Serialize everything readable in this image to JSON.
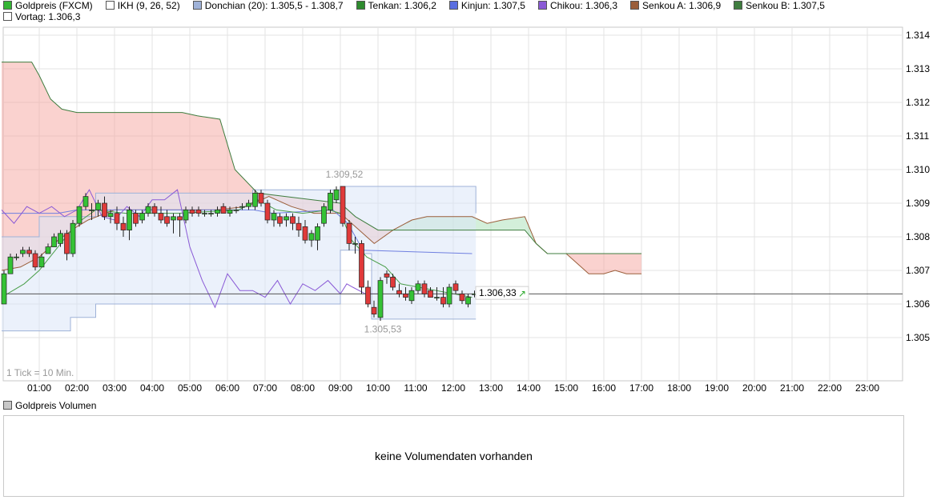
{
  "legend": {
    "items": [
      {
        "label": "Goldpreis (FXCM)",
        "color": "#35b535",
        "icon": "filled-square"
      },
      {
        "label": "IKH (9, 26, 52)",
        "color": "#ffffff",
        "icon": "empty-square"
      },
      {
        "label": "Donchian (20): 1.305,5 - 1.308,7",
        "color": "#9fb2d8",
        "icon": "filled-square"
      },
      {
        "label": "Tenkan: 1.306,2",
        "color": "#2e8b2e",
        "icon": "filled-square"
      },
      {
        "label": "Kinjun: 1.307,5",
        "color": "#5a6ee0",
        "icon": "filled-square"
      },
      {
        "label": "Chikou: 1.306,3",
        "color": "#8a5ad6",
        "icon": "filled-square"
      },
      {
        "label": "Senkou A: 1.306,9",
        "color": "#9a5e3a",
        "icon": "filled-square"
      },
      {
        "label": "Senkou B: 1.307,5",
        "color": "#3f7d3f",
        "icon": "filled-square"
      }
    ],
    "vortag": {
      "label": "Vortag: 1.306,3",
      "color": "#ffffff",
      "icon": "empty-square"
    }
  },
  "chart_data": {
    "type": "candlestick",
    "title": "",
    "y_ticks": [
      "1.314",
      "1.313",
      "1.312",
      "1.311",
      "1.310",
      "1.309",
      "1.308",
      "1.307",
      "1.306",
      "1.305"
    ],
    "ylim": [
      1304.4,
      1314.3
    ],
    "x_ticks": [
      "01:00",
      "02:00",
      "03:00",
      "04:00",
      "05:00",
      "06:00",
      "07:00",
      "08:00",
      "09:00",
      "10:00",
      "11:00",
      "12:00",
      "13:00",
      "14:00",
      "15:00",
      "16:00",
      "17:00",
      "18:00",
      "19:00",
      "20:00",
      "21:00",
      "22:00",
      "23:00"
    ],
    "xlim_hours": [
      0,
      24
    ],
    "grid": true,
    "tick_note": "1 Tick = 10 Min.",
    "annotations": {
      "high_label": "1.309,52",
      "low_label": "1.305,53",
      "last_label": "1.306,33"
    },
    "last_value": 1306.33,
    "vortag_line": 1306.3,
    "colors": {
      "up": "#35c235",
      "down": "#e03a3a",
      "cloud_bear": "#f5a5a0",
      "cloud_bull": "#a8dfb5",
      "donchian_fill": "#dbe6f8",
      "donchian_line": "#9fb2d8",
      "tenkan": "#4a9e4a",
      "kinjun": "#6f7fe0",
      "chikou": "#8a5ad6",
      "senkou_a": "#9a5e3a",
      "senkou_b": "#3f7d3f",
      "vortag": "#555555"
    },
    "candles": [
      {
        "t": 0.0,
        "o": 1306.0,
        "h": 1307.0,
        "l": 1306.0,
        "c": 1306.9
      },
      {
        "t": 0.17,
        "o": 1306.9,
        "h": 1307.5,
        "l": 1306.9,
        "c": 1307.4
      },
      {
        "t": 0.33,
        "o": 1307.4,
        "h": 1307.5,
        "l": 1307.3,
        "c": 1307.4
      },
      {
        "t": 0.5,
        "o": 1307.5,
        "h": 1307.7,
        "l": 1307.4,
        "c": 1307.6
      },
      {
        "t": 0.67,
        "o": 1307.6,
        "h": 1307.7,
        "l": 1307.4,
        "c": 1307.5
      },
      {
        "t": 0.83,
        "o": 1307.5,
        "h": 1307.6,
        "l": 1307.0,
        "c": 1307.1
      },
      {
        "t": 1.0,
        "o": 1307.1,
        "h": 1307.5,
        "l": 1307.1,
        "c": 1307.4
      },
      {
        "t": 1.17,
        "o": 1307.5,
        "h": 1307.8,
        "l": 1307.5,
        "c": 1307.7
      },
      {
        "t": 1.33,
        "o": 1307.7,
        "h": 1308.1,
        "l": 1307.7,
        "c": 1308.0
      },
      {
        "t": 1.5,
        "o": 1307.8,
        "h": 1308.2,
        "l": 1307.7,
        "c": 1308.1
      },
      {
        "t": 1.67,
        "o": 1308.1,
        "h": 1308.2,
        "l": 1307.3,
        "c": 1307.5
      },
      {
        "t": 1.83,
        "o": 1307.5,
        "h": 1308.5,
        "l": 1307.4,
        "c": 1308.4
      },
      {
        "t": 2.0,
        "o": 1308.4,
        "h": 1308.9,
        "l": 1308.3,
        "c": 1308.9
      },
      {
        "t": 2.17,
        "o": 1308.9,
        "h": 1309.3,
        "l": 1308.8,
        "c": 1309.2
      },
      {
        "t": 2.33,
        "o": 1308.8,
        "h": 1309.0,
        "l": 1308.5,
        "c": 1308.8
      },
      {
        "t": 2.5,
        "o": 1308.8,
        "h": 1309.1,
        "l": 1308.6,
        "c": 1309.0
      },
      {
        "t": 2.67,
        "o": 1309.0,
        "h": 1309.2,
        "l": 1308.5,
        "c": 1308.6
      },
      {
        "t": 2.83,
        "o": 1308.6,
        "h": 1308.8,
        "l": 1308.4,
        "c": 1308.7
      },
      {
        "t": 3.0,
        "o": 1308.7,
        "h": 1308.9,
        "l": 1308.2,
        "c": 1308.4
      },
      {
        "t": 3.17,
        "o": 1308.4,
        "h": 1308.6,
        "l": 1308.0,
        "c": 1308.2
      },
      {
        "t": 3.33,
        "o": 1308.2,
        "h": 1308.9,
        "l": 1307.9,
        "c": 1308.8
      },
      {
        "t": 3.5,
        "o": 1308.7,
        "h": 1308.8,
        "l": 1308.3,
        "c": 1308.4
      },
      {
        "t": 3.67,
        "o": 1308.5,
        "h": 1308.8,
        "l": 1308.4,
        "c": 1308.7
      },
      {
        "t": 3.83,
        "o": 1308.7,
        "h": 1309.0,
        "l": 1308.6,
        "c": 1308.9
      },
      {
        "t": 4.0,
        "o": 1308.9,
        "h": 1309.0,
        "l": 1308.6,
        "c": 1308.7
      },
      {
        "t": 4.17,
        "o": 1308.7,
        "h": 1308.9,
        "l": 1308.4,
        "c": 1308.5
      },
      {
        "t": 4.33,
        "o": 1308.6,
        "h": 1308.8,
        "l": 1308.3,
        "c": 1308.4
      },
      {
        "t": 4.5,
        "o": 1308.5,
        "h": 1308.7,
        "l": 1308.1,
        "c": 1308.6
      },
      {
        "t": 4.67,
        "o": 1308.6,
        "h": 1308.7,
        "l": 1308.0,
        "c": 1308.5
      },
      {
        "t": 4.83,
        "o": 1308.5,
        "h": 1308.9,
        "l": 1308.4,
        "c": 1308.8
      },
      {
        "t": 5.0,
        "o": 1308.8,
        "h": 1308.9,
        "l": 1308.6,
        "c": 1308.7
      },
      {
        "t": 5.17,
        "o": 1308.8,
        "h": 1308.9,
        "l": 1308.6,
        "c": 1308.7
      },
      {
        "t": 5.33,
        "o": 1308.7,
        "h": 1308.8,
        "l": 1308.6,
        "c": 1308.7
      },
      {
        "t": 5.5,
        "o": 1308.7,
        "h": 1308.8,
        "l": 1308.6,
        "c": 1308.7
      },
      {
        "t": 5.67,
        "o": 1308.7,
        "h": 1308.9,
        "l": 1308.6,
        "c": 1308.8
      },
      {
        "t": 5.83,
        "o": 1308.9,
        "h": 1309.0,
        "l": 1308.7,
        "c": 1308.7
      },
      {
        "t": 6.0,
        "o": 1308.7,
        "h": 1308.9,
        "l": 1308.6,
        "c": 1308.8
      },
      {
        "t": 6.17,
        "o": 1308.8,
        "h": 1308.9,
        "l": 1308.7,
        "c": 1308.8
      },
      {
        "t": 6.33,
        "o": 1308.9,
        "h": 1309.0,
        "l": 1308.8,
        "c": 1308.9
      },
      {
        "t": 6.5,
        "o": 1308.9,
        "h": 1309.1,
        "l": 1308.8,
        "c": 1309.0
      },
      {
        "t": 6.67,
        "o": 1308.9,
        "h": 1309.4,
        "l": 1308.8,
        "c": 1309.3
      },
      {
        "t": 6.83,
        "o": 1309.3,
        "h": 1309.4,
        "l": 1308.9,
        "c": 1309.0
      },
      {
        "t": 7.0,
        "o": 1309.0,
        "h": 1309.1,
        "l": 1308.4,
        "c": 1308.5
      },
      {
        "t": 7.17,
        "o": 1308.5,
        "h": 1308.8,
        "l": 1308.3,
        "c": 1308.7
      },
      {
        "t": 7.33,
        "o": 1308.6,
        "h": 1308.7,
        "l": 1308.3,
        "c": 1308.4
      },
      {
        "t": 7.5,
        "o": 1308.5,
        "h": 1308.7,
        "l": 1308.3,
        "c": 1308.6
      },
      {
        "t": 7.67,
        "o": 1308.6,
        "h": 1308.7,
        "l": 1308.2,
        "c": 1308.4
      },
      {
        "t": 7.83,
        "o": 1308.4,
        "h": 1308.6,
        "l": 1308.0,
        "c": 1308.2
      },
      {
        "t": 8.0,
        "o": 1308.3,
        "h": 1308.5,
        "l": 1307.8,
        "c": 1307.9
      },
      {
        "t": 8.17,
        "o": 1307.9,
        "h": 1308.2,
        "l": 1307.7,
        "c": 1308.1
      },
      {
        "t": 8.33,
        "o": 1307.9,
        "h": 1308.4,
        "l": 1307.6,
        "c": 1308.3
      },
      {
        "t": 8.5,
        "o": 1308.4,
        "h": 1309.0,
        "l": 1308.3,
        "c": 1308.9
      },
      {
        "t": 8.67,
        "o": 1308.8,
        "h": 1309.4,
        "l": 1308.7,
        "c": 1309.3
      },
      {
        "t": 8.83,
        "o": 1309.1,
        "h": 1309.5,
        "l": 1309.0,
        "c": 1309.4
      },
      {
        "t": 9.0,
        "o": 1309.5,
        "h": 1309.5,
        "l": 1308.3,
        "c": 1308.4
      },
      {
        "t": 9.17,
        "o": 1308.4,
        "h": 1308.5,
        "l": 1307.6,
        "c": 1307.8
      },
      {
        "t": 9.33,
        "o": 1307.8,
        "h": 1308.0,
        "l": 1307.5,
        "c": 1307.8
      },
      {
        "t": 9.5,
        "o": 1307.8,
        "h": 1307.9,
        "l": 1306.3,
        "c": 1306.5
      },
      {
        "t": 9.67,
        "o": 1306.5,
        "h": 1306.7,
        "l": 1305.9,
        "c": 1306.0
      },
      {
        "t": 9.83,
        "o": 1305.9,
        "h": 1306.1,
        "l": 1305.6,
        "c": 1305.7
      },
      {
        "t": 10.0,
        "o": 1305.6,
        "h": 1306.8,
        "l": 1305.5,
        "c": 1306.7
      },
      {
        "t": 10.17,
        "o": 1306.9,
        "h": 1307.0,
        "l": 1306.6,
        "c": 1306.8
      },
      {
        "t": 10.33,
        "o": 1306.8,
        "h": 1306.9,
        "l": 1306.4,
        "c": 1306.5
      },
      {
        "t": 10.5,
        "o": 1306.4,
        "h": 1306.6,
        "l": 1306.2,
        "c": 1306.3
      },
      {
        "t": 10.67,
        "o": 1306.3,
        "h": 1306.5,
        "l": 1306.1,
        "c": 1306.2
      },
      {
        "t": 10.83,
        "o": 1306.1,
        "h": 1306.5,
        "l": 1306.0,
        "c": 1306.4
      },
      {
        "t": 11.0,
        "o": 1306.4,
        "h": 1306.7,
        "l": 1306.3,
        "c": 1306.6
      },
      {
        "t": 11.17,
        "o": 1306.6,
        "h": 1306.7,
        "l": 1306.2,
        "c": 1306.3
      },
      {
        "t": 11.33,
        "o": 1306.4,
        "h": 1306.5,
        "l": 1306.2,
        "c": 1306.2
      },
      {
        "t": 11.5,
        "o": 1306.2,
        "h": 1306.5,
        "l": 1306.1,
        "c": 1306.2
      },
      {
        "t": 11.67,
        "o": 1306.2,
        "h": 1306.5,
        "l": 1305.9,
        "c": 1306.0
      },
      {
        "t": 11.83,
        "o": 1306.0,
        "h": 1306.6,
        "l": 1305.9,
        "c": 1306.5
      },
      {
        "t": 12.0,
        "o": 1306.6,
        "h": 1306.7,
        "l": 1306.3,
        "c": 1306.4
      },
      {
        "t": 12.17,
        "o": 1306.3,
        "h": 1306.4,
        "l": 1306.0,
        "c": 1306.1
      },
      {
        "t": 12.33,
        "o": 1306.0,
        "h": 1306.3,
        "l": 1305.9,
        "c": 1306.2
      },
      {
        "t": 12.5,
        "o": 1306.3,
        "h": 1306.4,
        "l": 1306.2,
        "c": 1306.3
      }
    ],
    "donchian": [
      {
        "t": 0.0,
        "u": 1308.0,
        "l": 1305.2
      },
      {
        "t": 1.0,
        "u": 1308.6,
        "l": 1305.2
      },
      {
        "t": 1.83,
        "u": 1308.6,
        "l": 1305.6
      },
      {
        "t": 2.5,
        "u": 1309.3,
        "l": 1306.0
      },
      {
        "t": 3.33,
        "u": 1309.3,
        "l": 1306.0
      },
      {
        "t": 6.67,
        "u": 1309.4,
        "l": 1306.0
      },
      {
        "t": 9.0,
        "u": 1309.5,
        "l": 1307.6
      },
      {
        "t": 9.5,
        "u": 1309.5,
        "l": 1307.5
      },
      {
        "t": 9.83,
        "u": 1309.5,
        "l": 1305.55
      },
      {
        "t": 12.5,
        "u": 1309.5,
        "l": 1305.55
      },
      {
        "t": 12.6,
        "u": 1308.7,
        "l": 1305.55
      }
    ],
    "tenkan": [
      {
        "t": 0.0,
        "v": 1306.2
      },
      {
        "t": 0.6,
        "v": 1306.6
      },
      {
        "t": 1.0,
        "v": 1307.0
      },
      {
        "t": 1.5,
        "v": 1307.7
      },
      {
        "t": 2.0,
        "v": 1308.4
      },
      {
        "t": 2.5,
        "v": 1308.8
      },
      {
        "t": 3.3,
        "v": 1308.7
      },
      {
        "t": 4.7,
        "v": 1308.7
      },
      {
        "t": 6.3,
        "v": 1308.8
      },
      {
        "t": 6.8,
        "v": 1309.1
      },
      {
        "t": 7.3,
        "v": 1308.8
      },
      {
        "t": 8.0,
        "v": 1308.7
      },
      {
        "t": 8.7,
        "v": 1308.8
      },
      {
        "t": 9.0,
        "v": 1308.7
      },
      {
        "t": 9.3,
        "v": 1307.9
      },
      {
        "t": 9.7,
        "v": 1307.4
      },
      {
        "t": 10.2,
        "v": 1307.1
      },
      {
        "t": 10.6,
        "v": 1306.6
      },
      {
        "t": 12.5,
        "v": 1306.2
      }
    ],
    "kinjun": [
      {
        "t": 0.0,
        "v": 1308.7
      },
      {
        "t": 1.5,
        "v": 1308.7
      },
      {
        "t": 2.0,
        "v": 1308.8
      },
      {
        "t": 6.7,
        "v": 1308.8
      },
      {
        "t": 7.2,
        "v": 1308.7
      },
      {
        "t": 8.8,
        "v": 1308.8
      },
      {
        "t": 9.2,
        "v": 1308.4
      },
      {
        "t": 9.6,
        "v": 1307.6
      },
      {
        "t": 12.5,
        "v": 1307.5
      }
    ],
    "chikou": [
      {
        "t": 0.0,
        "v": 1308.8
      },
      {
        "t": 0.33,
        "v": 1308.4
      },
      {
        "t": 0.67,
        "v": 1308.9
      },
      {
        "t": 1.0,
        "v": 1308.7
      },
      {
        "t": 1.33,
        "v": 1308.9
      },
      {
        "t": 1.67,
        "v": 1308.6
      },
      {
        "t": 2.0,
        "v": 1308.8
      },
      {
        "t": 2.33,
        "v": 1309.4
      },
      {
        "t": 2.67,
        "v": 1308.6
      },
      {
        "t": 3.0,
        "v": 1308.5
      },
      {
        "t": 3.33,
        "v": 1308.9
      },
      {
        "t": 3.67,
        "v": 1308.6
      },
      {
        "t": 4.0,
        "v": 1309.1
      },
      {
        "t": 4.33,
        "v": 1309.1
      },
      {
        "t": 4.67,
        "v": 1309.4
      },
      {
        "t": 5.0,
        "v": 1307.7
      },
      {
        "t": 5.33,
        "v": 1306.7
      },
      {
        "t": 5.67,
        "v": 1305.9
      },
      {
        "t": 6.0,
        "v": 1306.9
      },
      {
        "t": 6.33,
        "v": 1306.4
      },
      {
        "t": 6.67,
        "v": 1306.4
      },
      {
        "t": 7.0,
        "v": 1306.2
      },
      {
        "t": 7.33,
        "v": 1306.7
      },
      {
        "t": 7.67,
        "v": 1306.0
      },
      {
        "t": 8.0,
        "v": 1306.6
      },
      {
        "t": 8.33,
        "v": 1306.4
      },
      {
        "t": 8.67,
        "v": 1306.7
      },
      {
        "t": 9.0,
        "v": 1306.3
      },
      {
        "t": 9.17,
        "v": 1306.6
      },
      {
        "t": 9.33,
        "v": 1306.5
      },
      {
        "t": 9.67,
        "v": 1306.3
      },
      {
        "t": 9.83,
        "v": 1306.3
      },
      {
        "t": 10.0,
        "v": 1306.3
      }
    ],
    "senkou_a": [
      {
        "t": 0.0,
        "v": 1307.0
      },
      {
        "t": 0.5,
        "v": 1307.1
      },
      {
        "t": 1.0,
        "v": 1307.4
      },
      {
        "t": 1.5,
        "v": 1307.9
      },
      {
        "t": 2.0,
        "v": 1308.3
      },
      {
        "t": 2.3,
        "v": 1308.5
      },
      {
        "t": 3.0,
        "v": 1308.8
      },
      {
        "t": 5.7,
        "v": 1308.8
      },
      {
        "t": 6.5,
        "v": 1308.9
      },
      {
        "t": 7.1,
        "v": 1309.2
      },
      {
        "t": 7.7,
        "v": 1308.9
      },
      {
        "t": 8.3,
        "v": 1308.7
      },
      {
        "t": 9.0,
        "v": 1308.7
      },
      {
        "t": 9.4,
        "v": 1308.3
      },
      {
        "t": 9.9,
        "v": 1307.8
      },
      {
        "t": 10.4,
        "v": 1308.2
      },
      {
        "t": 10.9,
        "v": 1308.5
      },
      {
        "t": 11.3,
        "v": 1308.6
      },
      {
        "t": 12.5,
        "v": 1308.6
      },
      {
        "t": 12.9,
        "v": 1308.4
      },
      {
        "t": 13.3,
        "v": 1308.5
      },
      {
        "t": 13.9,
        "v": 1308.6
      },
      {
        "t": 14.2,
        "v": 1307.8
      },
      {
        "t": 14.5,
        "v": 1307.5
      },
      {
        "t": 15.0,
        "v": 1307.5
      },
      {
        "t": 15.3,
        "v": 1307.2
      },
      {
        "t": 15.6,
        "v": 1306.9
      },
      {
        "t": 16.0,
        "v": 1306.9
      },
      {
        "t": 16.3,
        "v": 1307.0
      },
      {
        "t": 16.6,
        "v": 1306.9
      },
      {
        "t": 17.0,
        "v": 1306.9
      }
    ],
    "senkou_b": [
      {
        "t": 0.0,
        "v": 1313.2
      },
      {
        "t": 0.8,
        "v": 1313.2
      },
      {
        "t": 1.0,
        "v": 1312.8
      },
      {
        "t": 1.3,
        "v": 1312.1
      },
      {
        "t": 1.6,
        "v": 1311.8
      },
      {
        "t": 2.0,
        "v": 1311.7
      },
      {
        "t": 4.8,
        "v": 1311.7
      },
      {
        "t": 5.2,
        "v": 1311.6
      },
      {
        "t": 5.8,
        "v": 1311.5
      },
      {
        "t": 6.2,
        "v": 1310.0
      },
      {
        "t": 6.8,
        "v": 1309.3
      },
      {
        "t": 9.0,
        "v": 1309.0
      },
      {
        "t": 9.4,
        "v": 1308.6
      },
      {
        "t": 10.0,
        "v": 1308.2
      },
      {
        "t": 12.5,
        "v": 1308.2
      },
      {
        "t": 13.3,
        "v": 1308.2
      },
      {
        "t": 13.9,
        "v": 1308.2
      },
      {
        "t": 14.2,
        "v": 1307.8
      },
      {
        "t": 14.5,
        "v": 1307.5
      },
      {
        "t": 17.0,
        "v": 1307.5
      }
    ]
  },
  "volume": {
    "title": "Goldpreis Volumen",
    "message": "keine Volumendaten vorhanden"
  }
}
